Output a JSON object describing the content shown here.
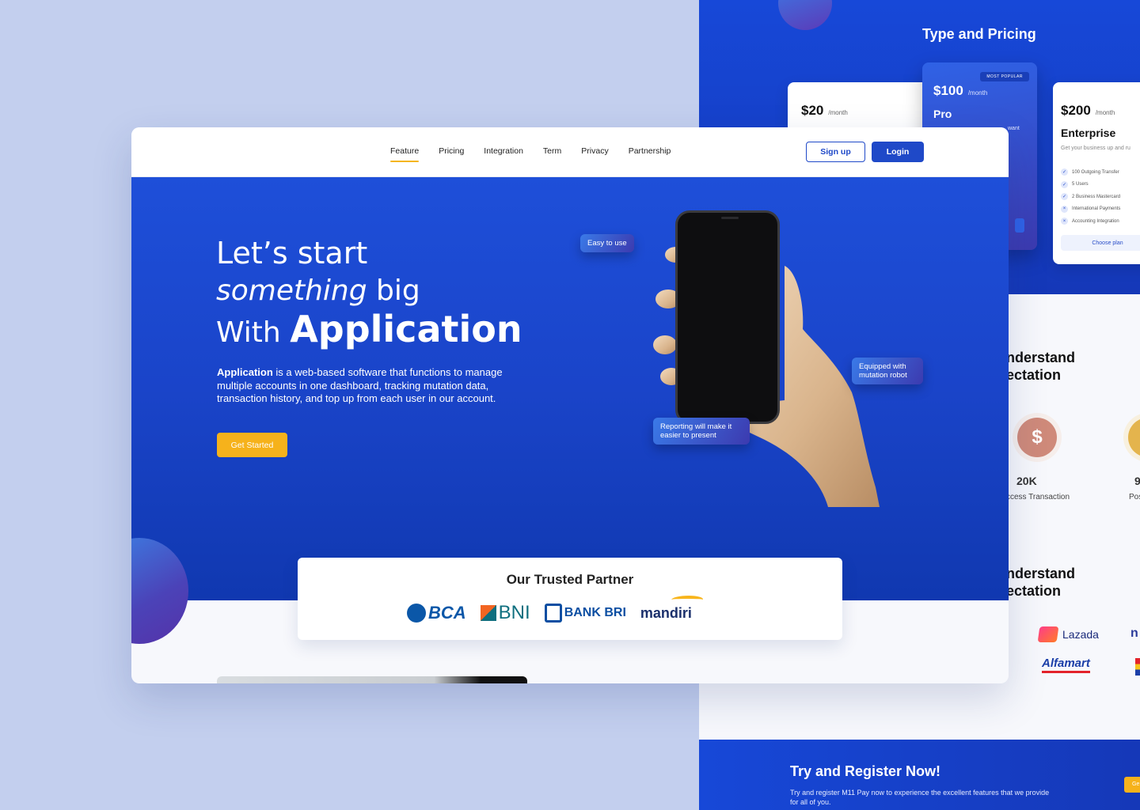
{
  "nav": {
    "links": [
      "Feature",
      "Pricing",
      "Integration",
      "Term",
      "Privacy",
      "Partnership"
    ],
    "signup_label": "Sign up",
    "login_label": "Login"
  },
  "hero": {
    "line1": "Let’s start",
    "line2_italic": "something",
    "line2_rest": " big",
    "line3_prefix": "With ",
    "line3_bold": "Application",
    "desc_bold": "Application",
    "desc_rest": " is a web-based software that functions to manage multiple accounts in one dashboard, tracking mutation data, transaction history, and top up from each user in our account.",
    "cta_label": "Get Started",
    "chips": {
      "easy": "Easy to use",
      "mutation": "Equipped with mutation robot",
      "reporting": "Reporting will make it easier to present"
    }
  },
  "partners": {
    "title": "Our Trusted Partner",
    "logos": [
      "BCA",
      "BNI",
      "BANK BRI",
      "mandiri"
    ]
  },
  "bg_page": {
    "pricing_title": "Type and Pricing",
    "plans": [
      {
        "price": "$20",
        "unit": "/month",
        "name": ""
      },
      {
        "price": "$100",
        "unit": "/month",
        "name": "Pro",
        "badge": "MOST POPULAR",
        "desc": "want"
      },
      {
        "price": "$200",
        "unit": "/month",
        "name": "Enterprise",
        "desc": "Get your business up and ru",
        "features": [
          "100 Outgoing Transfer",
          "5 Users",
          "2 Business Mastercard",
          "International Payments",
          "Accounting Integration"
        ],
        "feature_marks": [
          "✓",
          "✓",
          "✓",
          "×",
          "×"
        ],
        "button": "Choose plan"
      }
    ],
    "understand_1": [
      "nderstand",
      "ectation"
    ],
    "understand_2": [
      "nderstand",
      "ectation"
    ],
    "stats": [
      {
        "icon": "$",
        "value": "20K",
        "label": "ccess Transaction"
      },
      {
        "icon": "",
        "value": "9",
        "label": "Positi"
      }
    ],
    "brands": [
      "Lazada",
      "Alfamart",
      "n"
    ],
    "cta_title": "Try and Register Now!",
    "cta_text": "Try and register M11 Pay now to experience the excellent features that we provide for all of you.",
    "cta_btn": "Ge"
  }
}
